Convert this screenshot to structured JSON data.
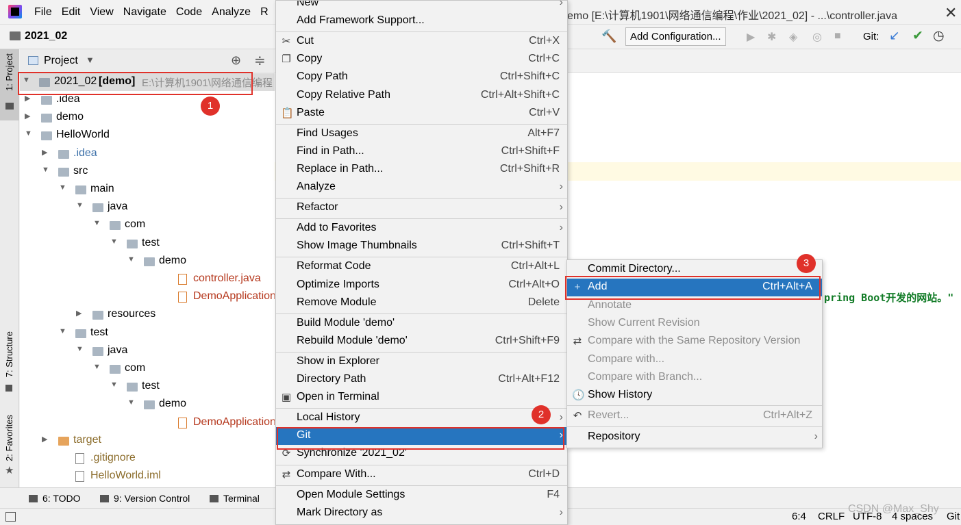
{
  "titlebar": {
    "menus": [
      "File",
      "Edit",
      "View",
      "Navigate",
      "Code",
      "Analyze",
      "R"
    ],
    "window_title": "emo [E:\\计算机1901\\网络通信编程\\作业\\2021_02] - ...\\controller.java",
    "close": "✕"
  },
  "navbar": {
    "project": "2021_02",
    "run_config": "Add Configuration...",
    "git_label": "Git:"
  },
  "left_strip": {
    "project_tab": "1: Project",
    "structure_tab": "7: Structure",
    "favorites_tab": "2: Favorites"
  },
  "project_panel": {
    "title": "Project",
    "root": {
      "name": "2021_02",
      "module": "[demo]",
      "path": "E:\\计算机1901\\网络通信编程"
    },
    "tree": [
      {
        "label": ".idea",
        "depth": 1,
        "kind": "folder",
        "arrow": "right"
      },
      {
        "label": "demo",
        "depth": 1,
        "kind": "folder",
        "arrow": "right"
      },
      {
        "label": "HelloWorld",
        "depth": 1,
        "kind": "folder",
        "arrow": "down"
      },
      {
        "label": ".idea",
        "depth": 2,
        "kind": "folder-muted",
        "arrow": "right"
      },
      {
        "label": "src",
        "depth": 2,
        "kind": "folder",
        "arrow": "down"
      },
      {
        "label": "main",
        "depth": 3,
        "kind": "folder",
        "arrow": "down"
      },
      {
        "label": "java",
        "depth": 4,
        "kind": "folder",
        "arrow": "down"
      },
      {
        "label": "com",
        "depth": 5,
        "kind": "folder",
        "arrow": "down"
      },
      {
        "label": "test",
        "depth": 6,
        "kind": "folder",
        "arrow": "down"
      },
      {
        "label": "demo",
        "depth": 7,
        "kind": "folder",
        "arrow": "down"
      },
      {
        "label": "controller.java",
        "depth": 9,
        "kind": "file",
        "arrow": ""
      },
      {
        "label": "DemoApplication",
        "depth": 9,
        "kind": "file",
        "arrow": ""
      },
      {
        "label": "resources",
        "depth": 4,
        "kind": "folder",
        "arrow": "right"
      },
      {
        "label": "test",
        "depth": 3,
        "kind": "folder",
        "arrow": "down"
      },
      {
        "label": "java",
        "depth": 4,
        "kind": "folder",
        "arrow": "down"
      },
      {
        "label": "com",
        "depth": 5,
        "kind": "folder",
        "arrow": "down"
      },
      {
        "label": "test",
        "depth": 6,
        "kind": "folder",
        "arrow": "down"
      },
      {
        "label": "demo",
        "depth": 7,
        "kind": "folder",
        "arrow": "down"
      },
      {
        "label": "DemoApplication",
        "depth": 9,
        "kind": "file",
        "arrow": ""
      },
      {
        "label": "target",
        "depth": 2,
        "kind": "folder-excluded",
        "arrow": "right"
      },
      {
        "label": ".gitignore",
        "depth": 3,
        "kind": "file-excluded",
        "arrow": ""
      },
      {
        "label": "HelloWorld.iml",
        "depth": 3,
        "kind": "file-excluded",
        "arrow": ""
      }
    ]
  },
  "editor": {
    "code_fragment": "pring Boot开发的网站。\""
  },
  "context_menu": {
    "items": [
      {
        "label": "New",
        "shortcut": "",
        "submenu": true,
        "icon": ""
      },
      {
        "label": "Add Framework Support...",
        "shortcut": "",
        "submenu": false,
        "icon": ""
      },
      {
        "sep": true
      },
      {
        "label": "Cut",
        "shortcut": "Ctrl+X",
        "submenu": false,
        "icon": "✂"
      },
      {
        "label": "Copy",
        "shortcut": "Ctrl+C",
        "submenu": false,
        "icon": "❐"
      },
      {
        "label": "Copy Path",
        "shortcut": "Ctrl+Shift+C",
        "submenu": false,
        "icon": ""
      },
      {
        "label": "Copy Relative Path",
        "shortcut": "Ctrl+Alt+Shift+C",
        "submenu": false,
        "icon": ""
      },
      {
        "label": "Paste",
        "shortcut": "Ctrl+V",
        "submenu": false,
        "icon": "📋"
      },
      {
        "sep": true
      },
      {
        "label": "Find Usages",
        "shortcut": "Alt+F7",
        "submenu": false,
        "icon": ""
      },
      {
        "label": "Find in Path...",
        "shortcut": "Ctrl+Shift+F",
        "submenu": false,
        "icon": ""
      },
      {
        "label": "Replace in Path...",
        "shortcut": "Ctrl+Shift+R",
        "submenu": false,
        "icon": ""
      },
      {
        "label": "Analyze",
        "shortcut": "",
        "submenu": true,
        "icon": ""
      },
      {
        "sep": true
      },
      {
        "label": "Refactor",
        "shortcut": "",
        "submenu": true,
        "icon": ""
      },
      {
        "sep": true
      },
      {
        "label": "Add to Favorites",
        "shortcut": "",
        "submenu": true,
        "icon": ""
      },
      {
        "label": "Show Image Thumbnails",
        "shortcut": "Ctrl+Shift+T",
        "submenu": false,
        "icon": ""
      },
      {
        "sep": true
      },
      {
        "label": "Reformat Code",
        "shortcut": "Ctrl+Alt+L",
        "submenu": false,
        "icon": ""
      },
      {
        "label": "Optimize Imports",
        "shortcut": "Ctrl+Alt+O",
        "submenu": false,
        "icon": ""
      },
      {
        "label": "Remove Module",
        "shortcut": "Delete",
        "submenu": false,
        "icon": ""
      },
      {
        "sep": true
      },
      {
        "label": "Build Module 'demo'",
        "shortcut": "",
        "submenu": false,
        "icon": ""
      },
      {
        "label": "Rebuild Module 'demo'",
        "shortcut": "Ctrl+Shift+F9",
        "submenu": false,
        "icon": ""
      },
      {
        "sep": true
      },
      {
        "label": "Show in Explorer",
        "shortcut": "",
        "submenu": false,
        "icon": ""
      },
      {
        "label": "Directory Path",
        "shortcut": "Ctrl+Alt+F12",
        "submenu": false,
        "icon": ""
      },
      {
        "label": "Open in Terminal",
        "shortcut": "",
        "submenu": false,
        "icon": "▣"
      },
      {
        "sep": true
      },
      {
        "label": "Local History",
        "shortcut": "",
        "submenu": true,
        "icon": ""
      },
      {
        "label": "Git",
        "shortcut": "",
        "submenu": true,
        "icon": "",
        "selected": true
      },
      {
        "label": "Synchronize '2021_02'",
        "shortcut": "",
        "submenu": false,
        "icon": "⟳"
      },
      {
        "sep": true
      },
      {
        "label": "Compare With...",
        "shortcut": "Ctrl+D",
        "submenu": false,
        "icon": "⇄"
      },
      {
        "sep": true
      },
      {
        "label": "Open Module Settings",
        "shortcut": "F4",
        "submenu": false,
        "icon": ""
      },
      {
        "label": "Mark Directory as",
        "shortcut": "",
        "submenu": true,
        "icon": ""
      }
    ]
  },
  "git_submenu": {
    "items": [
      {
        "label": "Commit Directory...",
        "shortcut": "",
        "disabled": false,
        "icon": ""
      },
      {
        "label": "Add",
        "shortcut": "Ctrl+Alt+A",
        "disabled": false,
        "icon": "+",
        "selected": true
      },
      {
        "label": "Annotate",
        "shortcut": "",
        "disabled": true,
        "icon": ""
      },
      {
        "label": "Show Current Revision",
        "shortcut": "",
        "disabled": true,
        "icon": ""
      },
      {
        "label": "Compare with the Same Repository Version",
        "shortcut": "",
        "disabled": true,
        "icon": "⇄"
      },
      {
        "label": "Compare with...",
        "shortcut": "",
        "disabled": true,
        "icon": ""
      },
      {
        "label": "Compare with Branch...",
        "shortcut": "",
        "disabled": true,
        "icon": ""
      },
      {
        "label": "Show History",
        "shortcut": "",
        "disabled": false,
        "icon": "🕓"
      },
      {
        "sep": true
      },
      {
        "label": "Revert...",
        "shortcut": "Ctrl+Alt+Z",
        "disabled": true,
        "icon": "↶"
      },
      {
        "sep": true
      },
      {
        "label": "Repository",
        "shortcut": "",
        "disabled": false,
        "icon": "",
        "submenu": true
      }
    ]
  },
  "bottom_tabs": [
    "6: TODO",
    "9: Version Control",
    "Terminal"
  ],
  "status": {
    "position": "6:4",
    "line_sep": "CRLF",
    "encoding": "UTF-8",
    "indent": "4 spaces",
    "vcs": "Git"
  },
  "watermark": "CSDN @Max_Shy",
  "callouts": [
    "1",
    "2",
    "3"
  ]
}
